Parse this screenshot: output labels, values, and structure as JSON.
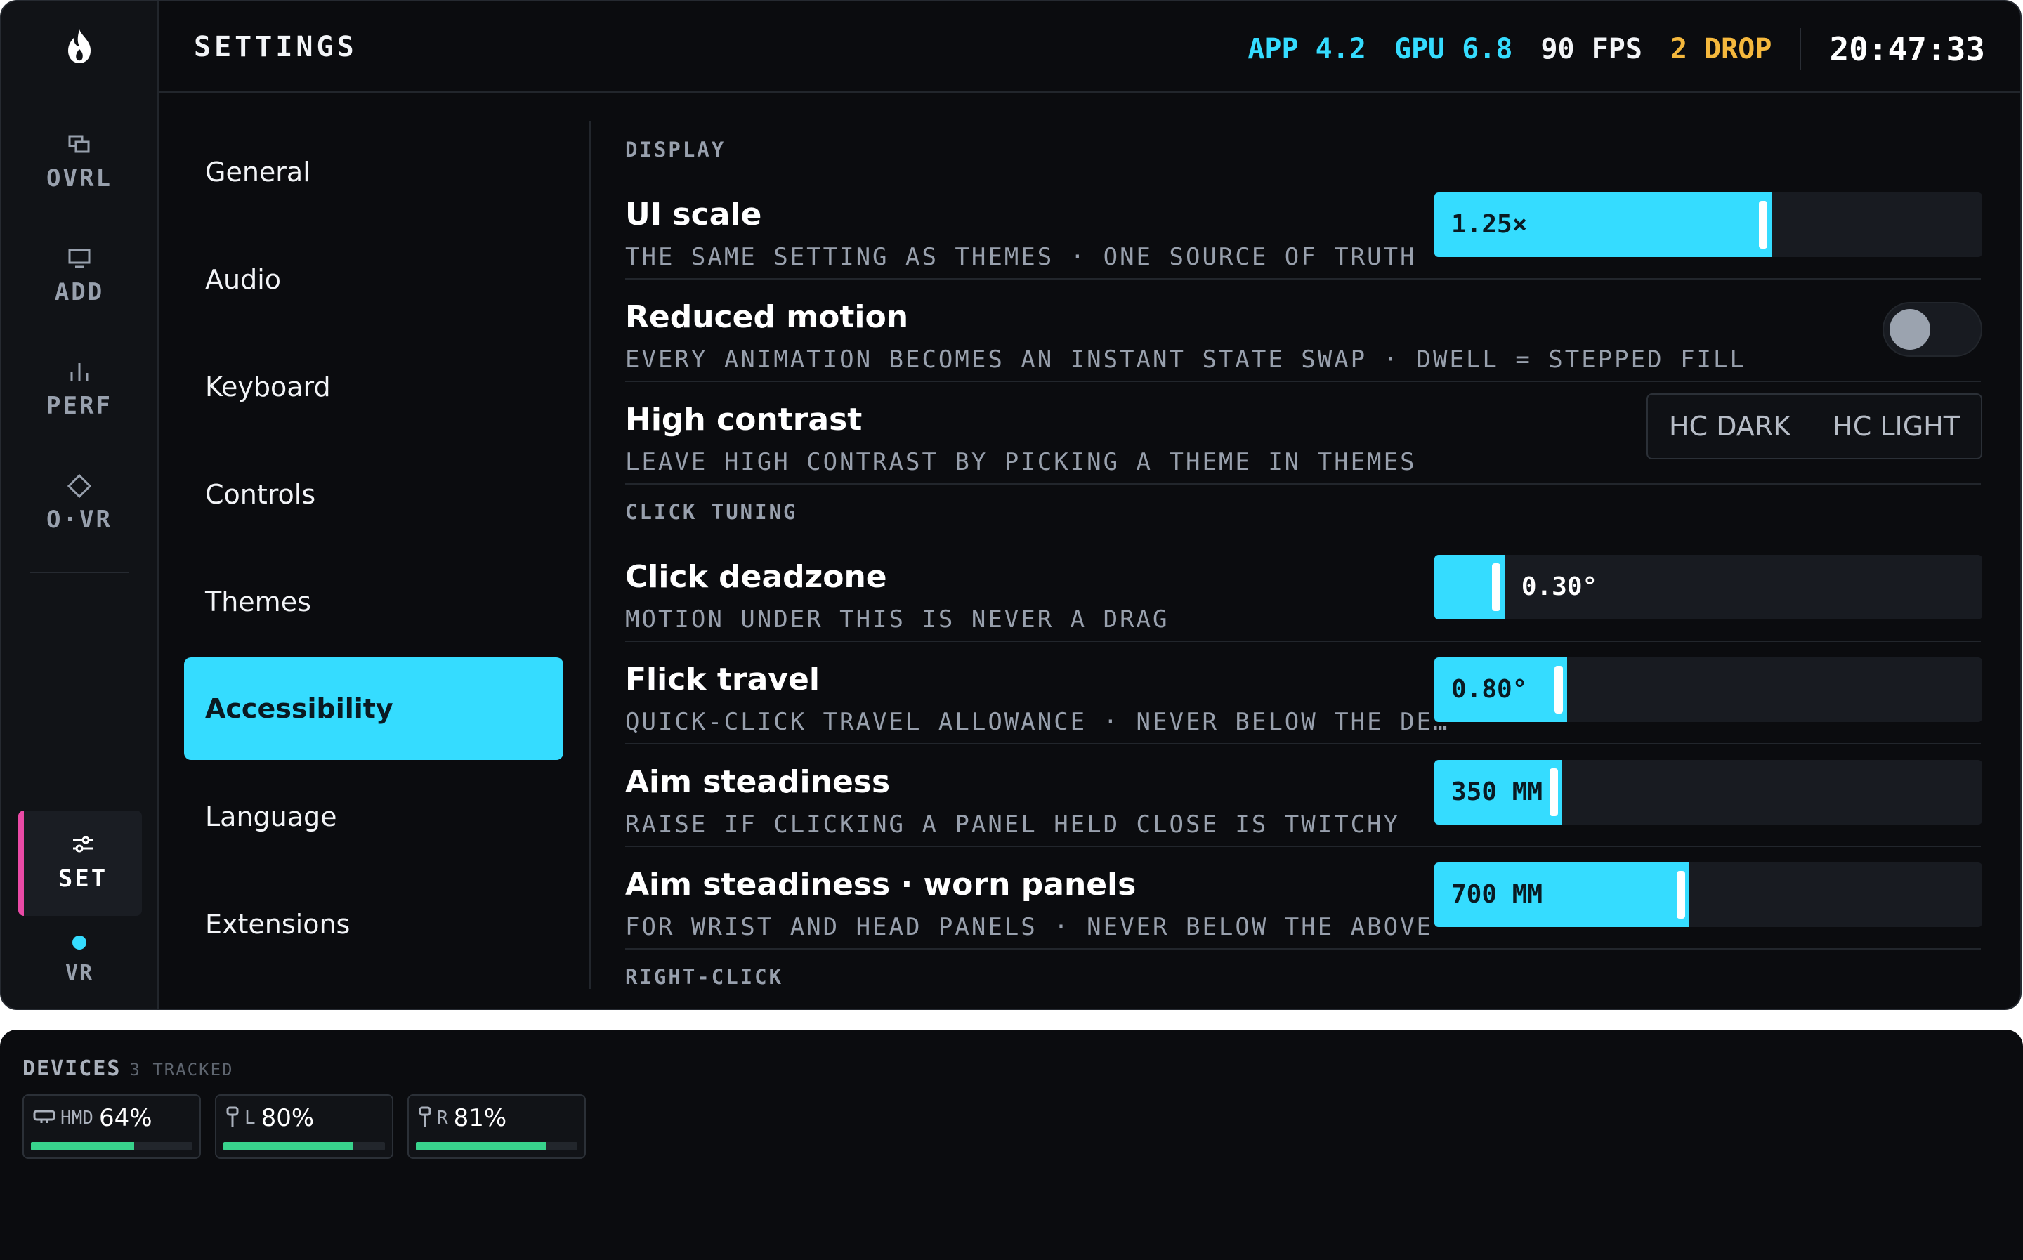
{
  "rail": {
    "items": [
      {
        "label": "OVRL",
        "icon": "overlay-icon"
      },
      {
        "label": "ADD",
        "icon": "monitor-icon"
      },
      {
        "label": "PERF",
        "icon": "bar-chart-icon"
      },
      {
        "label": "O·VR",
        "icon": "diamond-icon"
      }
    ],
    "active": {
      "label": "SET",
      "icon": "sliders-icon"
    },
    "vr_label": "VR"
  },
  "header": {
    "title": "SETTINGS",
    "app": "APP 4.2",
    "gpu": "GPU 6.8",
    "fps": "90 FPS",
    "drop": "2 DROP",
    "time": "20:47:33"
  },
  "nav": {
    "items": [
      "General",
      "Audio",
      "Keyboard",
      "Controls",
      "Themes",
      "Accessibility",
      "Language",
      "Extensions"
    ],
    "active": "Accessibility"
  },
  "sections": {
    "display": "DISPLAY",
    "click_tuning": "CLICK TUNING",
    "right_click": "RIGHT-CLICK"
  },
  "settings": {
    "ui_scale": {
      "title": "UI scale",
      "desc": "THE SAME SETTING AS THEMES · ONE SOURCE OF TRUTH",
      "value": "1.25×",
      "fill_fraction": 0.615
    },
    "reduced_motion": {
      "title": "Reduced motion",
      "desc": "EVERY ANIMATION BECOMES AN INSTANT STATE SWAP · DWELL = STEPPED FILL",
      "enabled": false
    },
    "high_contrast": {
      "title": "High contrast",
      "desc": "LEAVE HIGH CONTRAST BY PICKING A THEME IN THEMES",
      "options": [
        "HC DARK",
        "HC LIGHT"
      ]
    },
    "click_deadzone": {
      "title": "Click deadzone",
      "desc": "MOTION UNDER THIS IS NEVER A DRAG",
      "value": "0.30°",
      "fill_fraction": 0.128
    },
    "flick_travel": {
      "title": "Flick travel",
      "desc": "QUICK-CLICK TRAVEL ALLOWANCE · NEVER BELOW THE DE…",
      "value": "0.80°",
      "fill_fraction": 0.242
    },
    "aim_steadiness": {
      "title": "Aim steadiness",
      "desc": "RAISE IF CLICKING A PANEL HELD CLOSE IS TWITCHY",
      "value": "350 MM",
      "fill_fraction": 0.233
    },
    "aim_worn": {
      "title": "Aim steadiness · worn panels",
      "desc": "FOR WRIST AND HEAD PANELS · NEVER BELOW THE ABOVE",
      "value": "700 MM",
      "fill_fraction": 0.466
    }
  },
  "devices": {
    "title": "DEVICES",
    "subtitle": "3 TRACKED",
    "items": [
      {
        "name": "HMD",
        "percent": "64%",
        "level": 0.64,
        "icon": "headset-icon"
      },
      {
        "name": "L",
        "percent": "80%",
        "level": 0.8,
        "icon": "controller-icon"
      },
      {
        "name": "R",
        "percent": "81%",
        "level": 0.81,
        "icon": "controller-icon"
      }
    ]
  },
  "colors": {
    "accent": "#35dcff",
    "active_marker": "#ea4aa6",
    "warning": "#f5b83d",
    "battery": "#38d38c",
    "background": "#0b0c0f"
  }
}
